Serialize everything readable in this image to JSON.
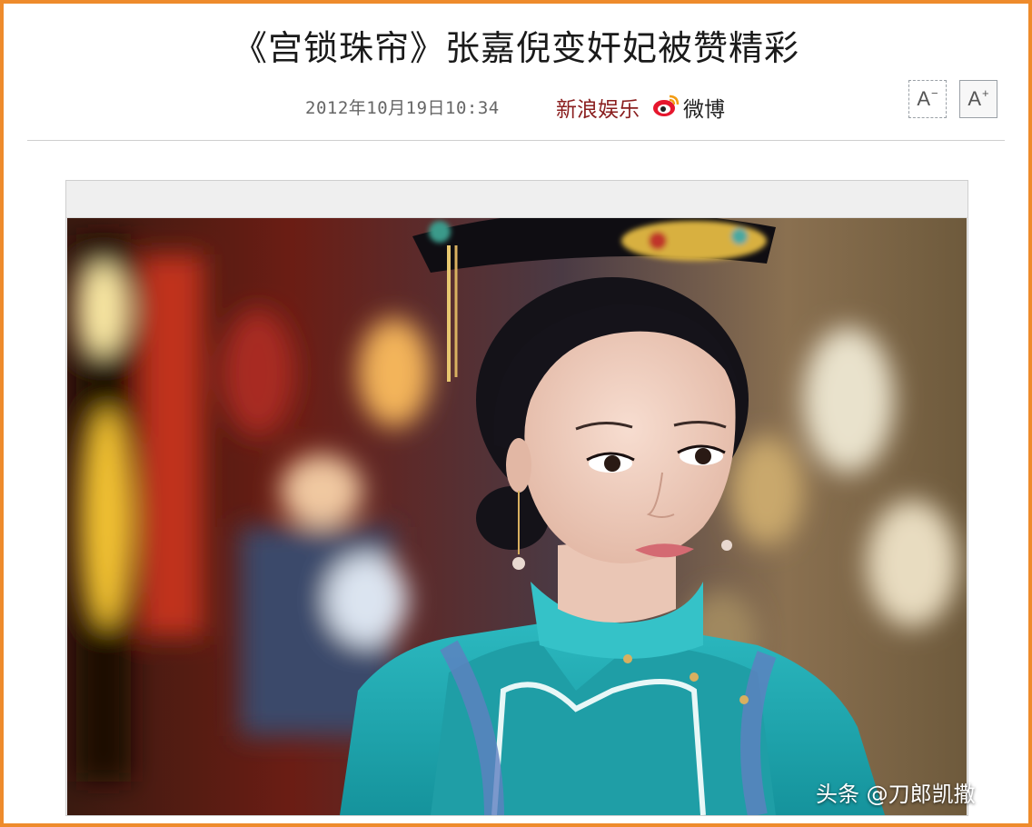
{
  "article": {
    "title": "《宫锁珠帘》张嘉倪变奸妃被赞精彩",
    "date": "2012年10月19日10:34",
    "source": "新浪娱乐",
    "weibo_label": "微博",
    "weibo_icon": "weibo-icon"
  },
  "toolbar": {
    "font_decrease_label": "A",
    "font_decrease_mark": "−",
    "font_increase_label": "A",
    "font_increase_mark": "+"
  },
  "watermark": "头条 @刀郎凯撒",
  "colors": {
    "frame": "#ee8b2c",
    "source_text": "#8a1e1e",
    "costume_teal": "#22a7b0"
  }
}
